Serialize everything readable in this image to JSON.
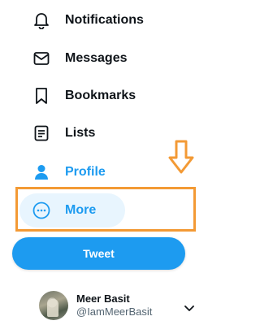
{
  "nav": {
    "notifications": {
      "label": "Notifications",
      "icon": "bell-icon"
    },
    "messages": {
      "label": "Messages",
      "icon": "envelope-icon"
    },
    "bookmarks": {
      "label": "Bookmarks",
      "icon": "bookmark-icon"
    },
    "lists": {
      "label": "Lists",
      "icon": "list-icon"
    },
    "profile": {
      "label": "Profile",
      "icon": "person-icon"
    },
    "more": {
      "label": "More",
      "icon": "more-circle-icon"
    }
  },
  "tweet_button": {
    "label": "Tweet"
  },
  "account": {
    "name": "Meer Basit",
    "handle": "@IamMeerBasit"
  },
  "colors": {
    "accent": "#1d9bf0",
    "annotation": "#f39a35",
    "more_hover_bg": "#e8f5fe"
  }
}
